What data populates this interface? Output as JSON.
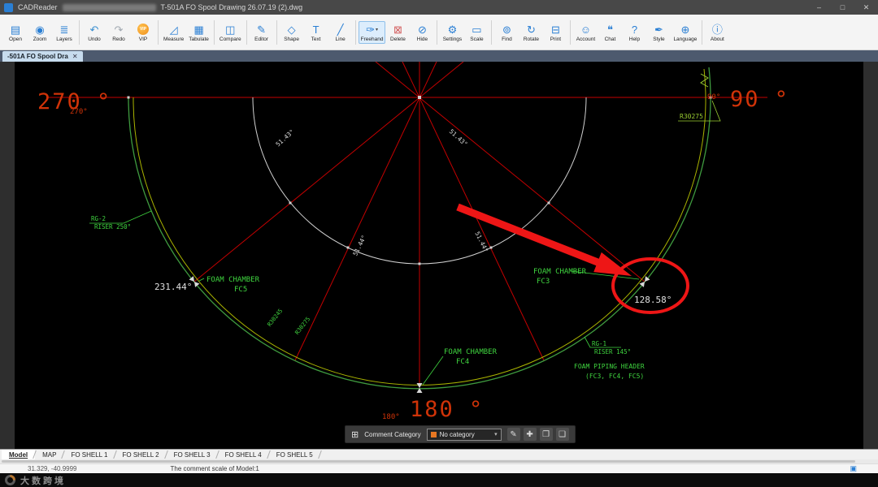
{
  "title_bar": {
    "app_name": "CADReader",
    "doc_title": "T-501A FO Spool Drawing 26.07.19 (2).dwg",
    "minimize": "–",
    "maximize": "□",
    "close": "✕"
  },
  "doc_tab": {
    "label": "-501A FO Spool Dra",
    "close": "✕"
  },
  "toolbar": {
    "items": [
      {
        "label": "Open",
        "glyph": "▤",
        "color": "#2a7fd4"
      },
      {
        "label": "Zoom",
        "glyph": "◉",
        "color": "#2a7fd4"
      },
      {
        "label": "Layers",
        "glyph": "≣",
        "color": "#2a7fd4"
      },
      {
        "sep": true
      },
      {
        "label": "Undo",
        "glyph": "↶",
        "color": "#3b8fd0"
      },
      {
        "label": "Redo",
        "glyph": "↷",
        "color": "#a0a8b0"
      },
      {
        "label": "VIP",
        "glyph": "VIP",
        "color": "#f59a23",
        "vip": true
      },
      {
        "sep": true
      },
      {
        "label": "Measure",
        "glyph": "◿",
        "color": "#2a7fd4"
      },
      {
        "label": "Tabulate",
        "glyph": "▦",
        "color": "#2a7fd4"
      },
      {
        "sep": true
      },
      {
        "label": "Compare",
        "glyph": "◫",
        "color": "#2a7fd4"
      },
      {
        "sep": true
      },
      {
        "label": "Editor",
        "glyph": "✎",
        "color": "#2a7fd4"
      },
      {
        "sep": true
      },
      {
        "label": "Shape",
        "glyph": "◇",
        "color": "#2a7fd4"
      },
      {
        "label": "Text",
        "glyph": "T",
        "color": "#2a7fd4"
      },
      {
        "label": "Line",
        "glyph": "╱",
        "color": "#2a7fd4"
      },
      {
        "sep": true
      },
      {
        "label": "Freehand",
        "glyph": "✑",
        "color": "#2a7fd4",
        "selected": true,
        "dropdown": "▾"
      },
      {
        "label": "Delete",
        "glyph": "⊠",
        "color": "#d25a5a"
      },
      {
        "label": "Hide",
        "glyph": "⊘",
        "color": "#2a7fd4"
      },
      {
        "sep": true
      },
      {
        "label": "Settings",
        "glyph": "⚙",
        "color": "#2a7fd4"
      },
      {
        "label": "Scale",
        "glyph": "▭",
        "color": "#2a7fd4"
      },
      {
        "sep": true
      },
      {
        "label": "Find",
        "glyph": "⊚",
        "color": "#2a7fd4"
      },
      {
        "label": "Rotate",
        "glyph": "↻",
        "color": "#2a7fd4"
      },
      {
        "label": "Print",
        "glyph": "⊟",
        "color": "#2a7fd4"
      },
      {
        "sep": true
      },
      {
        "label": "Account",
        "glyph": "☺",
        "color": "#2a7fd4"
      },
      {
        "label": "Chat",
        "glyph": "❝",
        "color": "#2a7fd4"
      },
      {
        "label": "Help",
        "glyph": "?",
        "color": "#2a7fd4"
      },
      {
        "label": "Style",
        "glyph": "✒",
        "color": "#2a7fd4"
      },
      {
        "label": "Language",
        "glyph": "⊕",
        "color": "#2a7fd4"
      },
      {
        "sep": true
      },
      {
        "label": "About",
        "glyph": "ⓘ",
        "color": "#2a7fd4"
      }
    ]
  },
  "drawing": {
    "angle_big_270": "270 °",
    "angle_small_270": "270°",
    "angle_big_90": "90 °",
    "angle_small_90": "90°",
    "angle_big_180": "180 °",
    "angle_small_180": "180°",
    "angle_fc5": "231.44°",
    "angle_fc3": "128.58°",
    "fc5_name": "FOAM CHAMBER",
    "fc5_tag": "FC5",
    "fc3_name": "FOAM CHAMBER",
    "fc3_tag": "FC3",
    "fc4_name": "FOAM CHAMBER",
    "fc4_tag": "FC4",
    "rg2": "RG-2",
    "rg2_riser": "RISER 250°",
    "rg1": "RG-1",
    "rg1_riser": "RISER 145°",
    "piping_header": "FOAM PIPING HEADER",
    "piping_header_tags": "(FC3, FC4, FC5)",
    "radius_main": "R30275",
    "radius_left_a": "R30245",
    "radius_left_b": "R30275",
    "span_tl": "51.43°",
    "span_tr": "51.43°",
    "span_ml": "51.44°",
    "span_mr": "51.44°",
    "colors": {
      "line_red": "#c40000",
      "arc_green": "#3f9b3f",
      "arc_yellow": "#aab400",
      "text_red": "#d03308",
      "text_green": "#3fd43f",
      "text_white": "#e0e0e0",
      "annotation_red": "#ee1616"
    }
  },
  "comment_bar": {
    "grid_icon": "⊞",
    "category_label": "Comment Category",
    "swatch_color": "#e87722",
    "selected_category": "No category",
    "dropdown_arrow": "▾",
    "icons": [
      {
        "name": "edit-icon",
        "glyph": "✎"
      },
      {
        "name": "move-icon",
        "glyph": "✚"
      },
      {
        "name": "copy-icon",
        "glyph": "❐"
      },
      {
        "name": "paste-icon",
        "glyph": "❏"
      }
    ]
  },
  "sheet_tabs": {
    "active": "Model",
    "tabs": [
      "Model",
      "MAP",
      "FO SHELL 1",
      "FO SHELL 2",
      "FO SHELL 3",
      "FO SHELL 4",
      "FO SHELL 5"
    ]
  },
  "status_bar": {
    "coords": "31.329, -40.9999",
    "message": "The comment scale of Model:1",
    "doc_icon": "▣"
  },
  "watermark": {
    "text": "大数跨境"
  }
}
